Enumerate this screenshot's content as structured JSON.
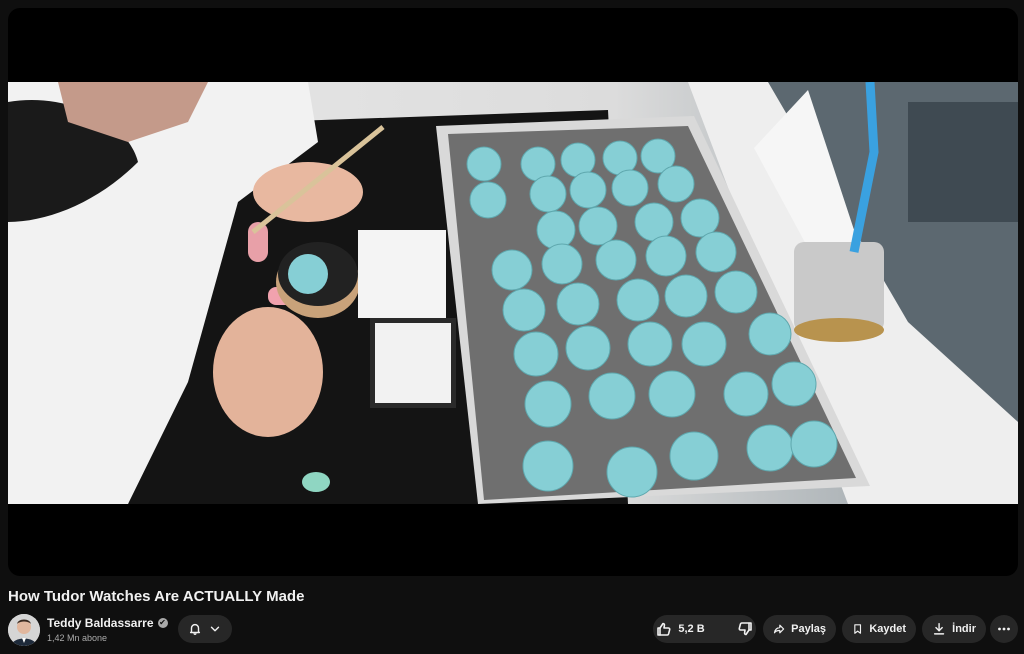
{
  "video": {
    "title": "How Tudor Watches Are ACTUALLY Made"
  },
  "channel": {
    "name": "Teddy Baldassarre",
    "verified_icon": "✔",
    "subscribers": "1,42 Mn abone"
  },
  "actions": {
    "like_count": "5,2 B",
    "share_label": "Paylaş",
    "save_label": "Kaydet",
    "download_label": "İndir"
  },
  "colors": {
    "background": "#0f0f0f",
    "button_bg": "#272727",
    "dial_color": "#86cfd5"
  }
}
